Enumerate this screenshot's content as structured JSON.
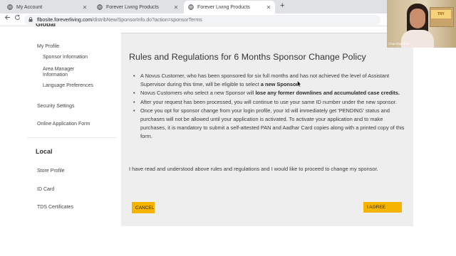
{
  "browser": {
    "tabs": [
      {
        "label": "My Account",
        "active": false
      },
      {
        "label": "Forever Living Products",
        "active": false
      },
      {
        "label": "Forever Living Products",
        "active": true
      }
    ],
    "new_tab_label": "+",
    "url_host": "flbosite.foreverliving.com",
    "url_path": "/distribNew/SponsorInfo.do?action=sponsorTerms"
  },
  "sidebar": {
    "heading_top": "Global",
    "profile_label": "My Profile",
    "profile_sub": [
      "Sponsor Information",
      "Area Manager",
      "Information",
      "Language Preferences"
    ],
    "security_label": "Security Settings",
    "online_app_label": "Online Application Form",
    "local_heading": "Local",
    "local_items": [
      "Store Profile",
      "ID Card",
      "TDS Certificates"
    ]
  },
  "policy": {
    "title": "Rules and Regulations for 6 Months Sponsor Change Policy",
    "rule1_a": "A Novus Customer, who has been sponsored for six full months and has not achieved the level of Assistant Supervisor during this time, will be eligible to select ",
    "rule1_b": "a new Sponsor.",
    "rule2_a": "Novus Customers who select a new Sponsor will ",
    "rule2_b": "lose any former downlines and accumulated case credits.",
    "rule3": "After your request has been processed, you will continue to use your same ID number under the new sponsor.",
    "rule4": "Once you opt for sponsor change from your login profile, your Id will immediately get 'PENDING' status and purchases will not be allowed until your application is activated. To activate your application and to make purchases, it is mandatory to submit a self-attested PAN and Aadhar Card copies along with a printed copy of this form.",
    "confirm_text": "I have read and understood above rules and regulations and I would like to proceed to change my sponsor.",
    "cancel_label": "CANCEL",
    "agree_label": "I AGREE"
  },
  "video": {
    "caption": "Chanchal Soni",
    "sign_text": "TRY"
  },
  "colors": {
    "accent": "#f6b400",
    "panel_bg": "#eeeeee"
  },
  "icons": [
    "globe-icon",
    "close-icon",
    "back-arrow-icon",
    "forward-arrow-icon",
    "reload-icon",
    "lock-icon",
    "cursor-icon"
  ]
}
